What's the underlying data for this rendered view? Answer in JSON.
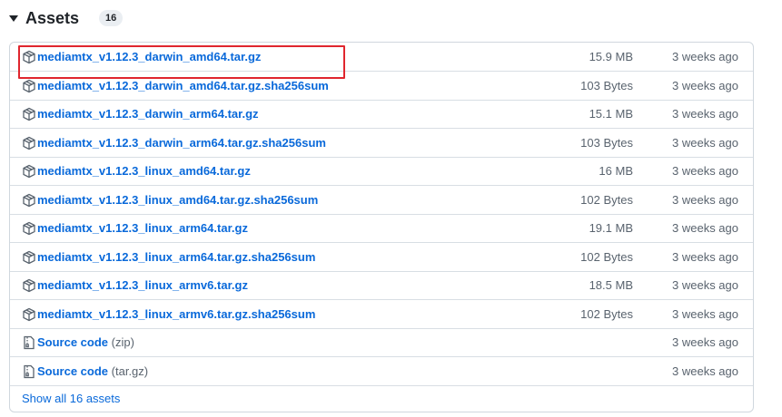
{
  "header": {
    "title": "Assets",
    "count": "16"
  },
  "assets": [
    {
      "name": "mediamtx_v1.12.3_darwin_amd64.tar.gz",
      "size": "15.9 MB",
      "date": "3 weeks ago"
    },
    {
      "name": "mediamtx_v1.12.3_darwin_amd64.tar.gz.sha256sum",
      "size": "103 Bytes",
      "date": "3 weeks ago"
    },
    {
      "name": "mediamtx_v1.12.3_darwin_arm64.tar.gz",
      "size": "15.1 MB",
      "date": "3 weeks ago"
    },
    {
      "name": "mediamtx_v1.12.3_darwin_arm64.tar.gz.sha256sum",
      "size": "103 Bytes",
      "date": "3 weeks ago"
    },
    {
      "name": "mediamtx_v1.12.3_linux_amd64.tar.gz",
      "size": "16 MB",
      "date": "3 weeks ago"
    },
    {
      "name": "mediamtx_v1.12.3_linux_amd64.tar.gz.sha256sum",
      "size": "102 Bytes",
      "date": "3 weeks ago"
    },
    {
      "name": "mediamtx_v1.12.3_linux_arm64.tar.gz",
      "size": "19.1 MB",
      "date": "3 weeks ago"
    },
    {
      "name": "mediamtx_v1.12.3_linux_arm64.tar.gz.sha256sum",
      "size": "102 Bytes",
      "date": "3 weeks ago"
    },
    {
      "name": "mediamtx_v1.12.3_linux_armv6.tar.gz",
      "size": "18.5 MB",
      "date": "3 weeks ago"
    },
    {
      "name": "mediamtx_v1.12.3_linux_armv6.tar.gz.sha256sum",
      "size": "102 Bytes",
      "date": "3 weeks ago"
    }
  ],
  "source": [
    {
      "label": "Source code",
      "suffix": "(zip)",
      "date": "3 weeks ago"
    },
    {
      "label": "Source code",
      "suffix": "(tar.gz)",
      "date": "3 weeks ago"
    }
  ],
  "show_all": "Show all 16 assets",
  "icons": {
    "asset": "package-icon",
    "source": "file-zip-icon",
    "toggle": "triangle-down-icon"
  },
  "colors": {
    "link": "#0969da",
    "muted": "#59636e",
    "border": "#d0d7de",
    "highlight": "#e0262e"
  }
}
